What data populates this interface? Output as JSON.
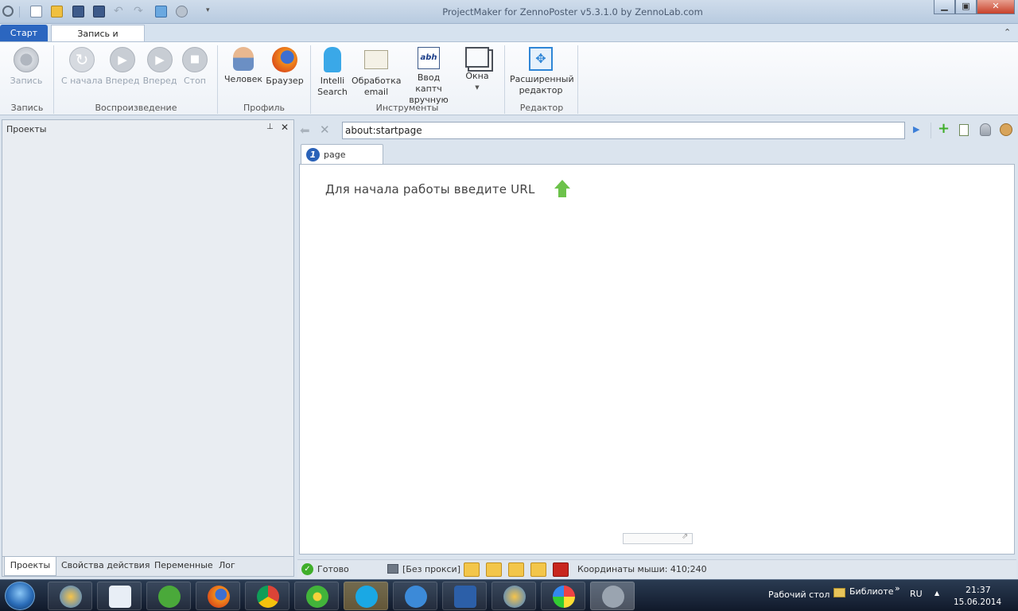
{
  "window": {
    "title": "ProjectMaker for ZennoPoster v5.3.1.0 by ZennoLab.com"
  },
  "ribbon": {
    "tabs": [
      {
        "label": "Старт"
      },
      {
        "label": "Запись и отладка"
      }
    ],
    "groups": {
      "record": {
        "label": "Запись",
        "buttons": [
          {
            "label": "Запись"
          }
        ]
      },
      "playback": {
        "label": "Воспроизведение",
        "buttons": [
          {
            "label": "С начала"
          },
          {
            "label": "Вперед"
          },
          {
            "label": "Вперед"
          },
          {
            "label": "Стоп"
          }
        ]
      },
      "profile": {
        "label": "Профиль",
        "buttons": [
          {
            "label": "Человек"
          },
          {
            "label": "Браузер"
          }
        ]
      },
      "tools": {
        "label": "Инструменты",
        "buttons": [
          {
            "label": "Intelli Search"
          },
          {
            "label": "Обработка email"
          },
          {
            "label": "Ввод каптч вручную"
          },
          {
            "label": "Окна"
          }
        ]
      },
      "editor": {
        "label": "Редактор",
        "buttons": [
          {
            "label": "Расширенный редактор"
          }
        ]
      }
    }
  },
  "left_panel": {
    "title": "Проекты",
    "tabs": [
      {
        "label": "Проекты"
      },
      {
        "label": "Свойства действия"
      },
      {
        "label": "Переменные"
      },
      {
        "label": "Лог"
      }
    ]
  },
  "browser": {
    "url": "about:startpage",
    "tab_label": "page",
    "start_hint": "Для начала работы введите URL"
  },
  "status_bar": {
    "status": "Готово",
    "proxy": "[Без прокси]",
    "mouse_coords": "Координаты мыши: 410;240"
  },
  "taskbar": {
    "desktop_label": "Рабочий стол",
    "library_label": "Библиоте",
    "language": "RU",
    "time": "21:37",
    "date": "15.06.2014"
  },
  "colors": {
    "accent": "#2b66c0",
    "ok_green": "#3fae2a",
    "arrow_green": "#6cc24a"
  }
}
